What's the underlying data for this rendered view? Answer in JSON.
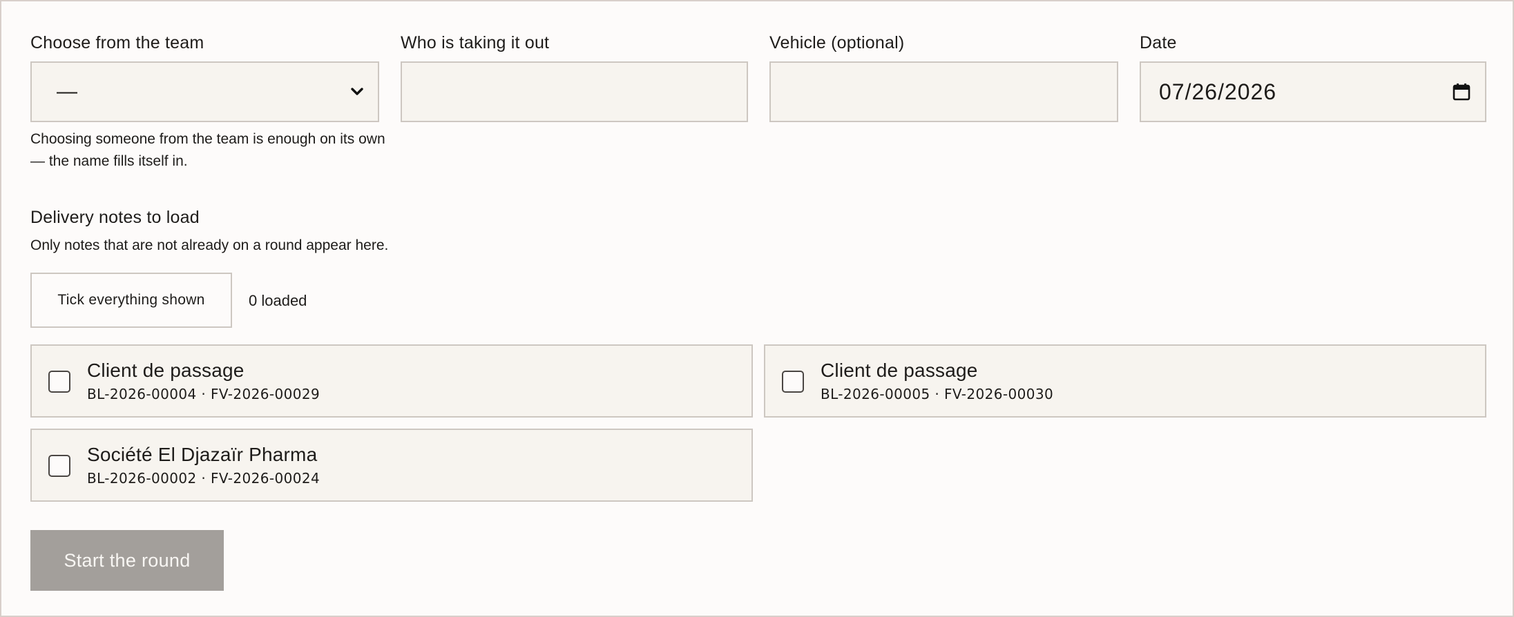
{
  "form": {
    "team_label": "Choose from the team",
    "team_selected": "—",
    "taker_label": "Who is taking it out",
    "taker_value": "",
    "vehicle_label": "Vehicle (optional)",
    "vehicle_value": "",
    "date_label": "Date",
    "date_value": "07/26/2026",
    "team_helper": "Choosing someone from the team is enough on its own — the name fills itself in."
  },
  "notes_section": {
    "title": "Delivery notes to load",
    "subtitle": "Only notes that are not already on a round appear here.",
    "tick_all_label": "Tick everything shown",
    "loaded_count": "0 loaded",
    "notes": [
      {
        "client": "Client de passage",
        "refs": "BL-2026-00004 · FV-2026-00029",
        "checked": false
      },
      {
        "client": "Client de passage",
        "refs": "BL-2026-00005 · FV-2026-00030",
        "checked": false
      },
      {
        "client": "Société El Djazaïr Pharma",
        "refs": "BL-2026-00002 · FV-2026-00024",
        "checked": false
      }
    ]
  },
  "actions": {
    "start_label": "Start the round"
  },
  "icons": {
    "select_arrow": "chevron-down-icon",
    "date_picker": "calendar-icon"
  },
  "colors": {
    "background": "#fdfbfa",
    "field_background": "#f7f4ef",
    "border": "#cdc7c1",
    "text": "#1e1c1a",
    "disabled_button": "#a39f9b"
  }
}
